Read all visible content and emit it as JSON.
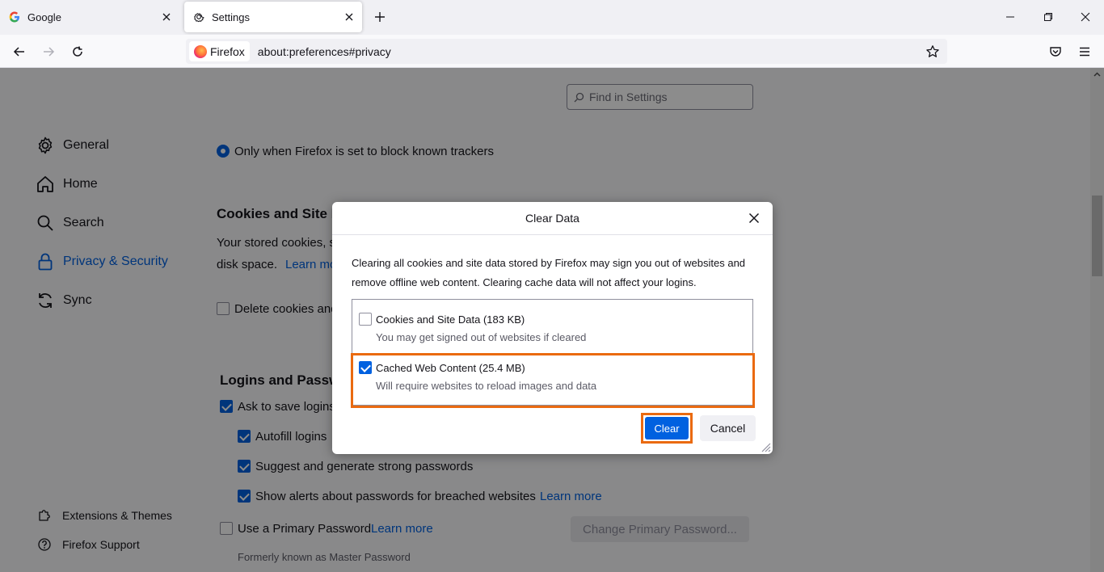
{
  "tabs": [
    {
      "title": "Google",
      "icon": "google-icon"
    },
    {
      "title": "Settings",
      "icon": "gear-icon",
      "active": true
    }
  ],
  "urlbar": {
    "identity_label": "Firefox",
    "url": "about:preferences#privacy"
  },
  "search": {
    "placeholder": "Find in Settings"
  },
  "sidebar": {
    "items": [
      {
        "label": "General",
        "icon": "gear-icon"
      },
      {
        "label": "Home",
        "icon": "home-icon"
      },
      {
        "label": "Search",
        "icon": "search-icon"
      },
      {
        "label": "Privacy & Security",
        "icon": "lock-icon",
        "selected": true
      },
      {
        "label": "Sync",
        "icon": "sync-icon"
      }
    ],
    "footer": [
      {
        "label": "Extensions & Themes",
        "icon": "puzzle-icon"
      },
      {
        "label": "Firefox Support",
        "icon": "help-icon"
      }
    ]
  },
  "content": {
    "radio_label": "Only when Firefox is set to block known trackers",
    "cookies_heading": "Cookies and Site D",
    "cookies_text_1": "Your stored cookies, s",
    "cookies_text_2": "disk space.",
    "cookies_learn_more": "Learn mo",
    "delete_cookies_label": "Delete cookies and",
    "logins_heading": "Logins and Passwo",
    "ask_save_logins": "Ask to save logins",
    "autofill_logins": "Autofill logins",
    "suggest_passwords": "Suggest and generate strong passwords",
    "breach_alerts": "Show alerts about passwords for breached websites",
    "breach_learn_more": "Learn more",
    "primary_password": "Use a Primary Password",
    "primary_learn_more": "Learn more",
    "change_primary_button": "Change Primary Password...",
    "formerly_known": "Formerly known as Master Password"
  },
  "dialog": {
    "title": "Clear Data",
    "description": "Clearing all cookies and site data stored by Firefox may sign you out of websites and remove offline web content. Clearing cache data will not affect your logins.",
    "options": [
      {
        "label": "Cookies and Site Data (183 KB)",
        "sublabel": "You may get signed out of websites if cleared",
        "checked": false
      },
      {
        "label": "Cached Web Content (25.4 MB)",
        "sublabel": "Will require websites to reload images and data",
        "checked": true
      }
    ],
    "clear_button": "Clear",
    "cancel_button": "Cancel"
  },
  "colors": {
    "accent": "#0061e0",
    "highlight": "#ea6a10"
  }
}
